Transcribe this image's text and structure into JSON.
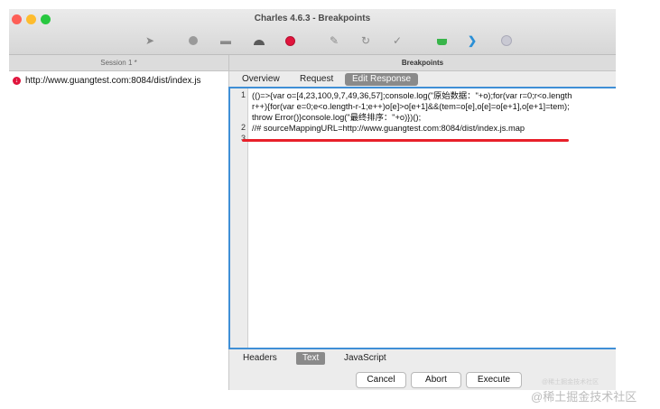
{
  "window": {
    "title": "Charles 4.6.3 - Breakpoints"
  },
  "toolbar": {
    "icons": [
      "pointer-icon",
      "record-icon",
      "throttle-icon",
      "turtle-icon",
      "breakpoint-icon",
      "pen-icon",
      "refresh-icon",
      "check-icon",
      "basket-icon",
      "tools-icon",
      "gear-icon"
    ]
  },
  "tabs": {
    "session": "Session 1 *",
    "breakpoints": "Breakpoints"
  },
  "sidebar": {
    "items": [
      {
        "label": "http://www.guangtest.com:8084/dist/index.js"
      }
    ]
  },
  "detail_tabs": [
    "Overview",
    "Request",
    "Edit Response"
  ],
  "editor": {
    "line_numbers": [
      "1",
      "2",
      "3"
    ],
    "lines": [
      "(()=>{var o=[4,23,100,9,7,49,36,57];console.log(\"原始数据：\"+o);for(var r=0;r<o.length",
      "r++){for(var e=0;e<o.length-r-1;e++)o[e]>o[e+1]&&(tem=o[e],o[e]=o[e+1],o[e+1]=tem);",
      "throw Error()}console.log(\"最终排序：\"+o)})();",
      "//# sourceMappingURL=http://www.guangtest.com:8084/dist/index.js.map",
      ""
    ]
  },
  "bottom_tabs": [
    "Headers",
    "Text",
    "JavaScript"
  ],
  "buttons": {
    "cancel": "Cancel",
    "abort": "Abort",
    "execute": "Execute"
  },
  "watermark": {
    "small": "@稀土掘金技术社区",
    "large": "@稀土掘金技术社区"
  }
}
